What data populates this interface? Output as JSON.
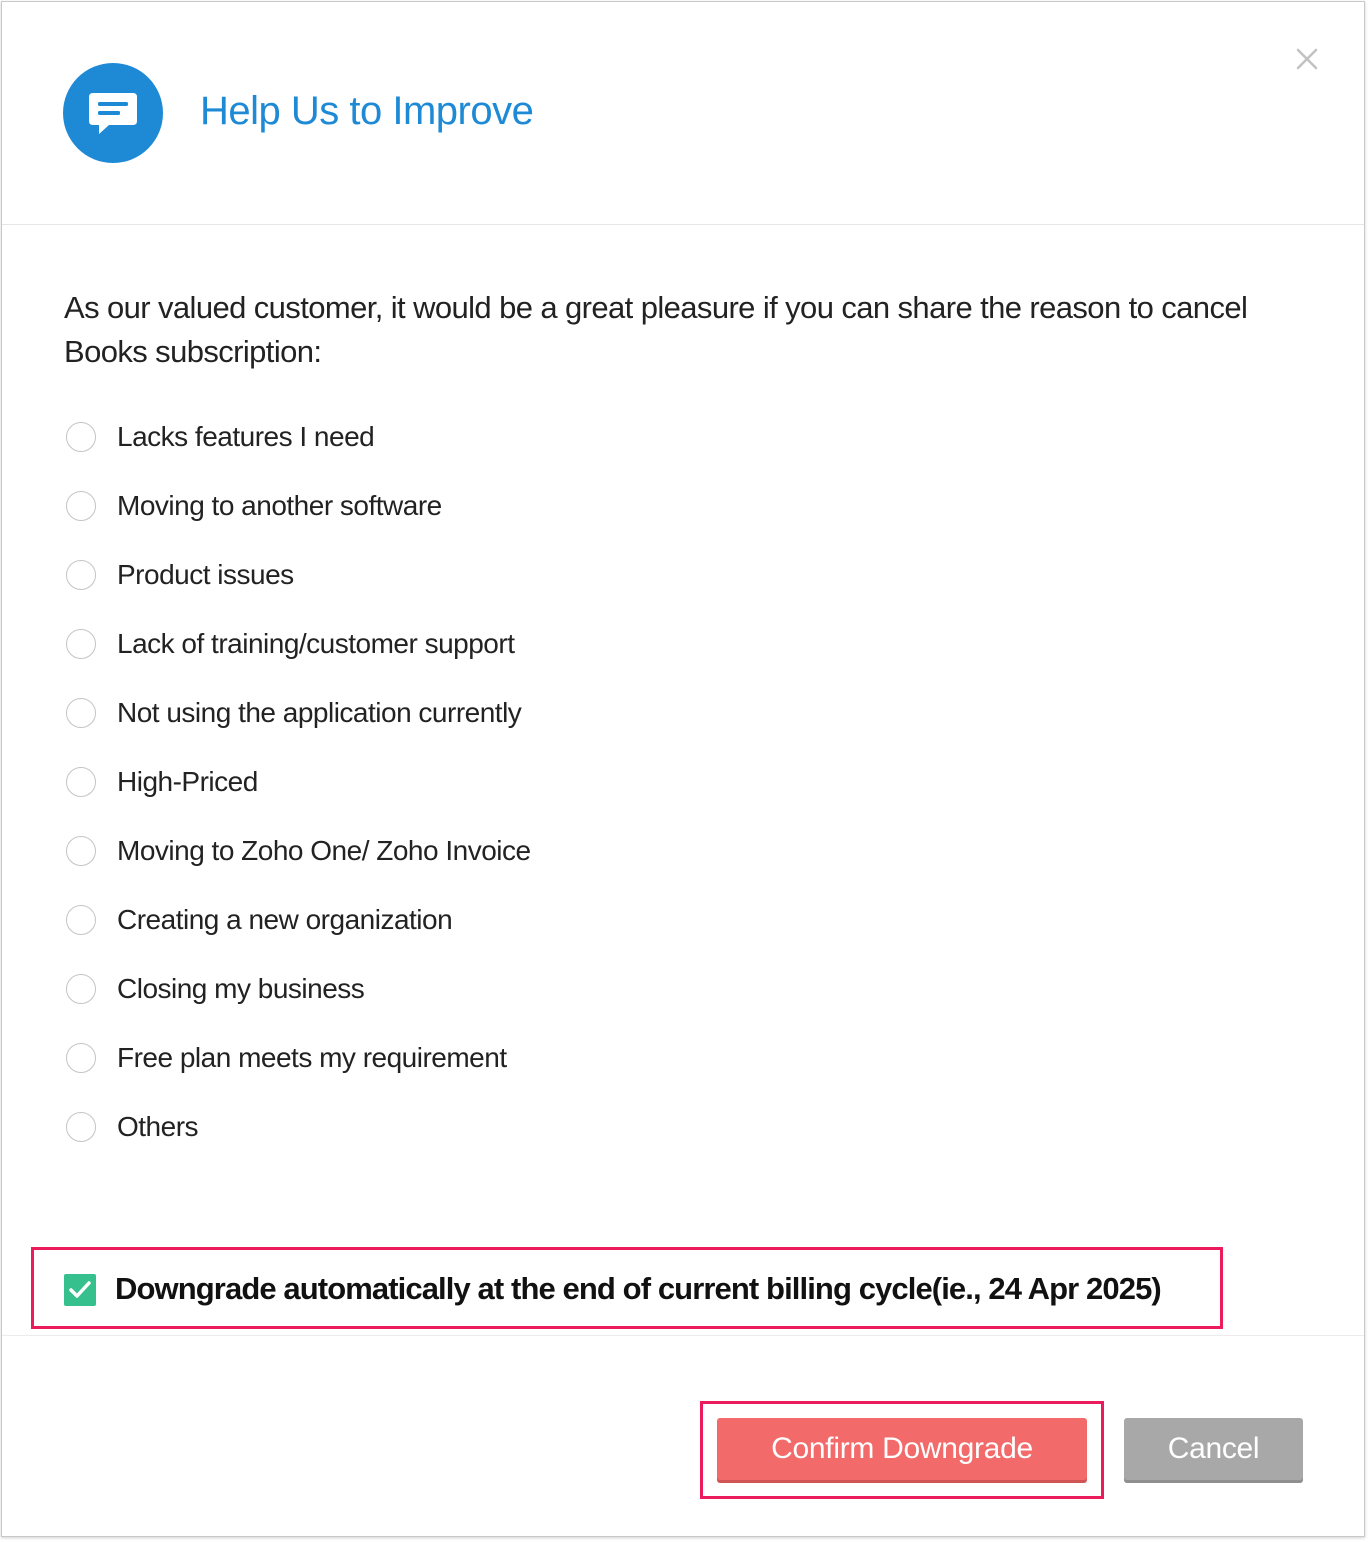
{
  "dialog": {
    "title": "Help Us to Improve",
    "header_icon": "chat-bubble-icon",
    "close_icon": "close-icon",
    "accent_color": "#1e8ad6"
  },
  "intro_text": "As our valued customer, it would be a great pleasure if you can share the reason to cancel Books subscription:",
  "reasons": [
    {
      "label": "Lacks features I need",
      "selected": false
    },
    {
      "label": "Moving to another software",
      "selected": false
    },
    {
      "label": "Product issues",
      "selected": false
    },
    {
      "label": "Lack of training/customer support",
      "selected": false
    },
    {
      "label": "Not using the application currently",
      "selected": false
    },
    {
      "label": "High-Priced",
      "selected": false
    },
    {
      "label": "Moving to Zoho One/ Zoho Invoice",
      "selected": false
    },
    {
      "label": "Creating a new organization",
      "selected": false
    },
    {
      "label": "Closing my business",
      "selected": false
    },
    {
      "label": "Free plan meets my requirement",
      "selected": false
    },
    {
      "label": "Others",
      "selected": false
    }
  ],
  "auto_downgrade": {
    "label": "Downgrade automatically at the end of current billing cycle(ie., 24 Apr 2025)",
    "checked": true,
    "checkbox_color": "#36c08d",
    "highlight_color": "#ec1b5c"
  },
  "footer": {
    "confirm_label": "Confirm Downgrade",
    "cancel_label": "Cancel",
    "confirm_color": "#f26a6a",
    "cancel_color": "#a8a8a8"
  }
}
